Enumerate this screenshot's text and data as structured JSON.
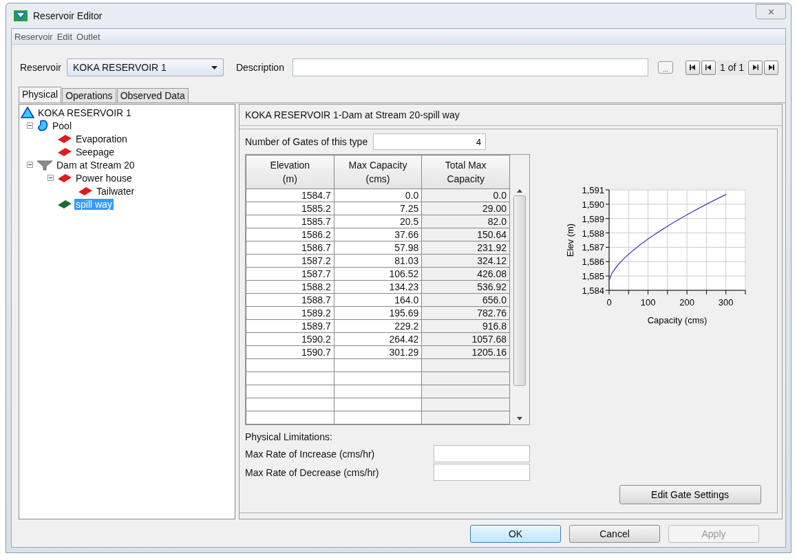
{
  "window": {
    "title": "Reservoir Editor",
    "close": "✕"
  },
  "menu": [
    "Reservoir",
    "Edit",
    "Outlet"
  ],
  "reservoir": {
    "label": "Reservoir",
    "value": "KOKA RESERVOIR 1"
  },
  "description": {
    "label": "Description",
    "button": "..."
  },
  "navigator": {
    "position": "1 of 1"
  },
  "tabs": [
    {
      "label": "Physical",
      "selected": true
    },
    {
      "label": "Operations",
      "selected": false
    },
    {
      "label": "Observed Data",
      "selected": false
    }
  ],
  "tree": [
    {
      "label": "KOKA RESERVOIR 1",
      "kind": "reservoir",
      "selected": false,
      "children": [
        {
          "label": "Pool",
          "kind": "pool",
          "selected": false,
          "expanded": true,
          "children": [
            {
              "label": "Evaporation",
              "kind": "diamond",
              "color": "#dd1c1c",
              "selected": false
            },
            {
              "label": "Seepage",
              "kind": "diamond",
              "color": "#dd1c1c",
              "selected": false
            }
          ]
        },
        {
          "label": "Dam at Stream 20",
          "kind": "dam",
          "selected": false,
          "expanded": true,
          "children": [
            {
              "label": "Power house",
              "kind": "diamond",
              "color": "#dd1c1c",
              "selected": false,
              "expanded": true,
              "children": [
                {
                  "label": "Tailwater",
                  "kind": "diamond",
                  "color": "#dd1c1c",
                  "selected": false
                }
              ]
            },
            {
              "label": "spill way",
              "kind": "diamond",
              "color": "#1e6b30",
              "selected": true
            }
          ]
        }
      ]
    }
  ],
  "panel": {
    "title": "KOKA RESERVOIR 1-Dam at Stream 20-spill way",
    "gates": {
      "label": "Number of Gates of this type",
      "value": "4"
    },
    "table": {
      "columns": [
        "Elevation\n(m)",
        "Max Capacity\n(cms)",
        "Total Max\nCapacity"
      ],
      "rows": [
        [
          "1584.7",
          "0.0",
          "0.0"
        ],
        [
          "1585.2",
          "7.25",
          "29.00"
        ],
        [
          "1585.7",
          "20.5",
          "82.0"
        ],
        [
          "1586.2",
          "37.66",
          "150.64"
        ],
        [
          "1586.7",
          "57.98",
          "231.92"
        ],
        [
          "1587.2",
          "81.03",
          "324.12"
        ],
        [
          "1587.7",
          "106.52",
          "426.08"
        ],
        [
          "1588.2",
          "134.23",
          "536.92"
        ],
        [
          "1588.7",
          "164.0",
          "656.0"
        ],
        [
          "1589.2",
          "195.69",
          "782.76"
        ],
        [
          "1589.7",
          "229.2",
          "916.8"
        ],
        [
          "1590.2",
          "264.42",
          "1057.68"
        ],
        [
          "1590.7",
          "301.29",
          "1205.16"
        ]
      ]
    },
    "chart_data": {
      "type": "line",
      "xlabel": "Capacity (cms)",
      "ylabel": "Elev (m)",
      "x": [
        0,
        7.25,
        20.5,
        37.66,
        57.98,
        81.03,
        106.52,
        134.23,
        164.0,
        195.69,
        229.2,
        264.42,
        301.29
      ],
      "grid": true,
      "series": [
        {
          "color": "#4040c0",
          "values": [
            1584.7,
            1585.2,
            1585.7,
            1586.2,
            1586.7,
            1587.2,
            1587.7,
            1588.2,
            1588.7,
            1589.2,
            1589.7,
            1590.2,
            1590.7
          ]
        }
      ],
      "xlim": [
        0,
        350
      ],
      "ylim": [
        1584,
        1591
      ],
      "xticks": [
        0,
        100,
        200,
        300
      ],
      "yticks": [
        {
          "value": 1584,
          "label": "1,584"
        },
        {
          "value": 1585,
          "label": "1,585"
        },
        {
          "value": 1586,
          "label": "1,586"
        },
        {
          "value": 1587,
          "label": "1,587"
        },
        {
          "value": 1588,
          "label": "1,588"
        },
        {
          "value": 1589,
          "label": "1,589"
        },
        {
          "value": 1590,
          "label": "1,590"
        },
        {
          "value": 1591,
          "label": "1,591"
        }
      ]
    },
    "limitations": {
      "title": "Physical Limitations:",
      "fields": [
        "Max Rate of Increase (cms/hr)",
        "Max Rate of Decrease (cms/hr)"
      ]
    },
    "edit_button": "Edit Gate Settings"
  },
  "buttons": [
    {
      "label": "OK",
      "disabled": false
    },
    {
      "label": "Cancel",
      "disabled": false
    },
    {
      "label": "Apply",
      "disabled": true
    }
  ]
}
